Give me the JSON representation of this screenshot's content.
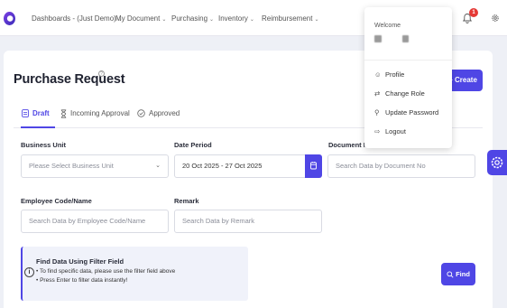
{
  "nav": {
    "items": [
      {
        "label": "Dashboards - (Just Demo)",
        "chev": "⌄"
      },
      {
        "label": "My Document",
        "chev": "⌄"
      },
      {
        "label": "Purchasing",
        "chev": "⌄"
      },
      {
        "label": "Inventory",
        "chev": "⌄"
      },
      {
        "label": "Reimbursement",
        "chev": "⌄"
      }
    ],
    "notification_count": "1"
  },
  "page": {
    "title": "Purchase Request",
    "create_label": "+ Create"
  },
  "tabs": [
    {
      "label": "Draft",
      "active": true
    },
    {
      "label": "Incoming Approval",
      "active": false
    },
    {
      "label": "Approved",
      "active": false
    }
  ],
  "filters": {
    "business_unit": {
      "label": "Business Unit",
      "placeholder": "Please Select Business Unit"
    },
    "date_period": {
      "label": "Date Period",
      "value": "20 Oct 2025 - 27 Oct 2025"
    },
    "document_no": {
      "label": "Document No",
      "placeholder": "Search Data by Document No"
    },
    "employee": {
      "label": "Employee Code/Name",
      "placeholder": "Search Data by Employee Code/Name"
    },
    "remark": {
      "label": "Remark",
      "placeholder": "Search Data by Remark"
    }
  },
  "info": {
    "title": "Find Data Using Filter Field",
    "line1": "• To find specific data, please use the filter field above",
    "line2": "• Press Enter to filter data instantly!"
  },
  "find_label": "Find",
  "user_menu": {
    "welcome": "Welcome",
    "items": [
      {
        "label": "Profile",
        "icon": "person-icon"
      },
      {
        "label": "Change Role",
        "icon": "switch-role-icon"
      },
      {
        "label": "Update Password",
        "icon": "key-icon"
      },
      {
        "label": "Logout",
        "icon": "logout-icon"
      }
    ]
  },
  "colors": {
    "accent": "#4f46e5",
    "badge": "#e53935"
  }
}
